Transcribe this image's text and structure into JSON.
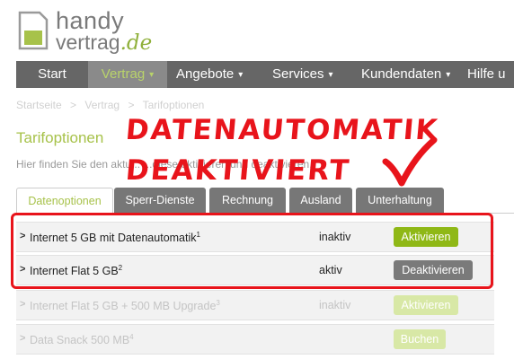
{
  "logo": {
    "line1": "handy",
    "line2_main": "vertrag",
    "line2_tld": ".de"
  },
  "nav": {
    "items": [
      {
        "label": "Start",
        "has_caret": false,
        "active": false
      },
      {
        "label": "Vertrag",
        "has_caret": true,
        "active": true
      },
      {
        "label": "Angebote",
        "has_caret": true,
        "active": false
      },
      {
        "label": "Services",
        "has_caret": true,
        "active": false
      },
      {
        "label": "Kundendaten",
        "has_caret": true,
        "active": false
      },
      {
        "label": "Hilfe u",
        "has_caret": false,
        "active": false
      }
    ],
    "caret_glyph": "▾"
  },
  "breadcrumb": {
    "items": [
      "Startseite",
      "Vertrag",
      "Tarifoptionen"
    ],
    "separator": ">"
  },
  "page": {
    "title": "Tarifoptionen",
    "intro": "Hier finden Sie den aktu... ...diese aktivieren und deaktivieren."
  },
  "tabs": [
    {
      "label": "Datenoptionen",
      "active": true
    },
    {
      "label": "Sperr-Dienste",
      "active": false
    },
    {
      "label": "Rechnung",
      "active": false
    },
    {
      "label": "Ausland",
      "active": false
    },
    {
      "label": "Unterhaltung",
      "active": false
    }
  ],
  "options": [
    {
      "name": "Internet 5 GB mit Datenautomatik",
      "footnote": "1",
      "status": "inaktiv",
      "action": "Aktivieren",
      "faded": false
    },
    {
      "name": "Internet Flat 5 GB",
      "footnote": "2",
      "status": "aktiv",
      "action": "Deaktivieren",
      "faded": false
    },
    {
      "name": "Internet Flat 5 GB + 500 MB Upgrade",
      "footnote": "3",
      "status": "inaktiv",
      "action": "Aktivieren",
      "faded": true
    },
    {
      "name": "Data Snack 500 MB",
      "footnote": "4",
      "status": "",
      "action": "Buchen",
      "faded": true
    }
  ],
  "annotation": {
    "line1": "DATENAUTOMATIK",
    "line2": "DEAKTIVIERT",
    "color": "#e8141b"
  },
  "colors": {
    "brand_green": "#8fb816",
    "nav_bg": "#666666",
    "accent_text": "#a7c24a"
  }
}
